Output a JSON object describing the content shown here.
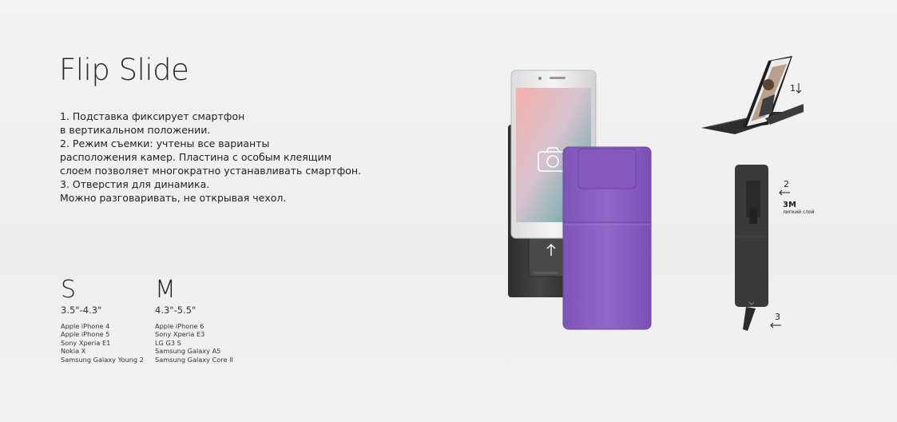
{
  "title": "Flip Slide",
  "features": [
    "1. Подставка фиксирует смартфон",
    "в вертикальном положении.",
    "2. Режим съемки: учтены все варианты",
    "расположения камер. Пластина с особым клеящим",
    "слоем позволяет многократно устанавливать смартфон.",
    "3. Отверстия для динамика.",
    "Можно разговаривать, не открывая чехол."
  ],
  "sizes": [
    {
      "letter": "S",
      "range": "3.5\"-4.3\"",
      "devices": [
        "Apple iPhone 4",
        "Apple iPhone 5",
        "Sony Xperia E1",
        "Nokia X",
        "Samsung Galaxy Young 2"
      ]
    },
    {
      "letter": "M",
      "range": "4.3\"-5.5\"",
      "devices": [
        "Apple iPhone 6",
        "Sony Xperia E3",
        "LG G3 S",
        "Samsung Galaxy A5",
        "Samsung Galaxy Core II"
      ]
    }
  ],
  "callouts": {
    "stand_number": "1",
    "adhesive_number": "2",
    "adhesive_brand": "3M",
    "adhesive_label": "липкий слой",
    "speaker_number": "3"
  },
  "colors": {
    "case_purple": "#8b61c2",
    "case_dark": "#3a3a3a",
    "accent_text": "#1e1e1e"
  },
  "icons": [
    "camera-icon",
    "arrow-up-icon",
    "arrow-down-icon",
    "arrow-left-icon"
  ]
}
